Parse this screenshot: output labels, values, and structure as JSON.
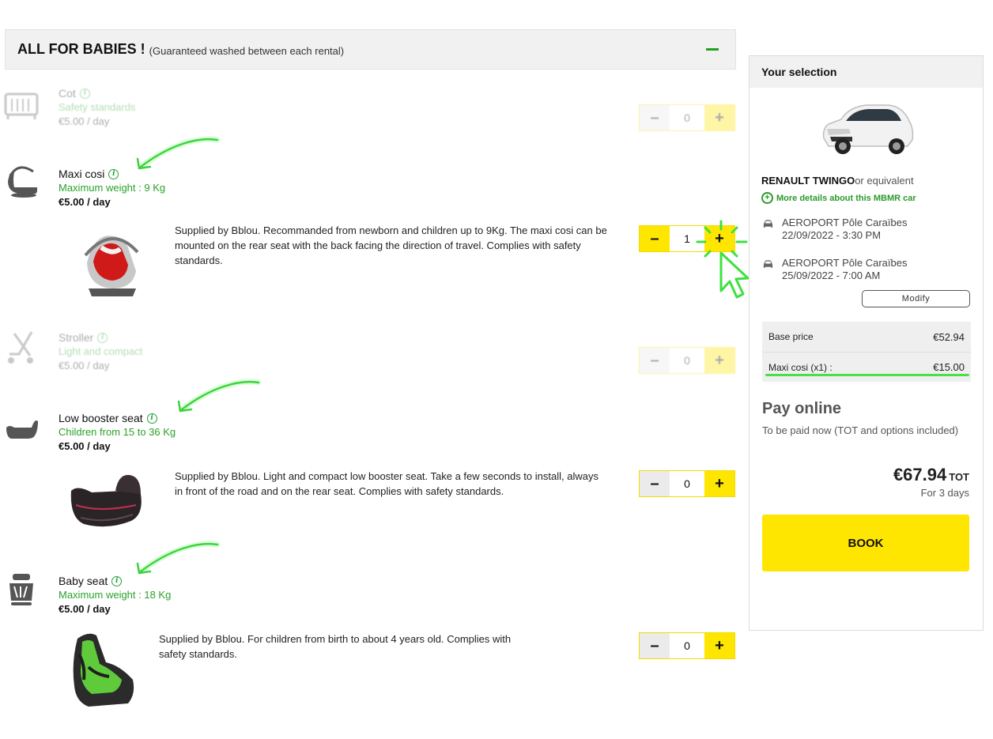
{
  "section": {
    "title": "ALL FOR BABIES !",
    "subtitle": "(Guaranteed washed between each rental)"
  },
  "items": [
    {
      "name": "Cot",
      "spec": "Safety standards",
      "price": "€5.00 / day",
      "quantity": "0",
      "icon": "crib-icon",
      "available": false
    },
    {
      "name": "Maxi cosi",
      "spec": "Maximum weight : 9 Kg",
      "price": "€5.00 / day",
      "description": "Supplied by Bblou. Recommanded from newborn and children up to 9Kg. The maxi cosi can be mounted on the rear seat with the back facing the direction of travel. Complies with safety standards.",
      "quantity": "1",
      "icon": "infant-carrier-icon",
      "available": true
    },
    {
      "name": "Stroller",
      "spec": "Light and compact",
      "price": "€5.00 / day",
      "quantity": "0",
      "icon": "stroller-icon",
      "available": false
    },
    {
      "name": "Low booster seat",
      "spec": "Children from 15 to 36 Kg",
      "price": "€5.00 / day",
      "description": "Supplied by Bblou. Light and compact low booster seat. Take a few seconds to install, always in front of the road and on the rear seat. Complies with safety standards.",
      "quantity": "0",
      "icon": "booster-seat-icon",
      "available": true
    },
    {
      "name": "Baby seat",
      "spec": "Maximum weight : 18 Kg",
      "price": "€5.00 / day",
      "description": "Supplied by Bblou. For children from birth to about 4 years old. Complies with safety standards.",
      "quantity": "0",
      "icon": "baby-seat-icon",
      "available": true
    }
  ],
  "stepper": {
    "minus": "–",
    "plus": "+"
  },
  "panel": {
    "title": "Your selection",
    "car_model": "RENAULT TWINGO",
    "car_suffix": "or equivalent",
    "details_link": "More details about this MBMR car",
    "pickup": {
      "place": "AEROPORT Pôle Caraïbes",
      "datetime": "22/09/2022 - 3:30 PM"
    },
    "dropoff": {
      "place": "AEROPORT Pôle Caraïbes",
      "datetime": "25/09/2022 - 7:00 AM"
    },
    "modify_label": "Modify",
    "price_rows": [
      {
        "label": "Base price",
        "value": "€52.94"
      },
      {
        "label": "Maxi cosi (x1) :",
        "value": "€15.00"
      }
    ],
    "pay_title": "Pay online",
    "pay_note": "To be paid now (TOT and options included)",
    "total": "€67.94",
    "total_suffix": "TOT",
    "duration": "For 3 days",
    "book_label": "BOOK"
  },
  "colors": {
    "accent_yellow": "#ffe600",
    "accent_green": "#2aa12a",
    "highlight_green": "#4ae04a"
  }
}
